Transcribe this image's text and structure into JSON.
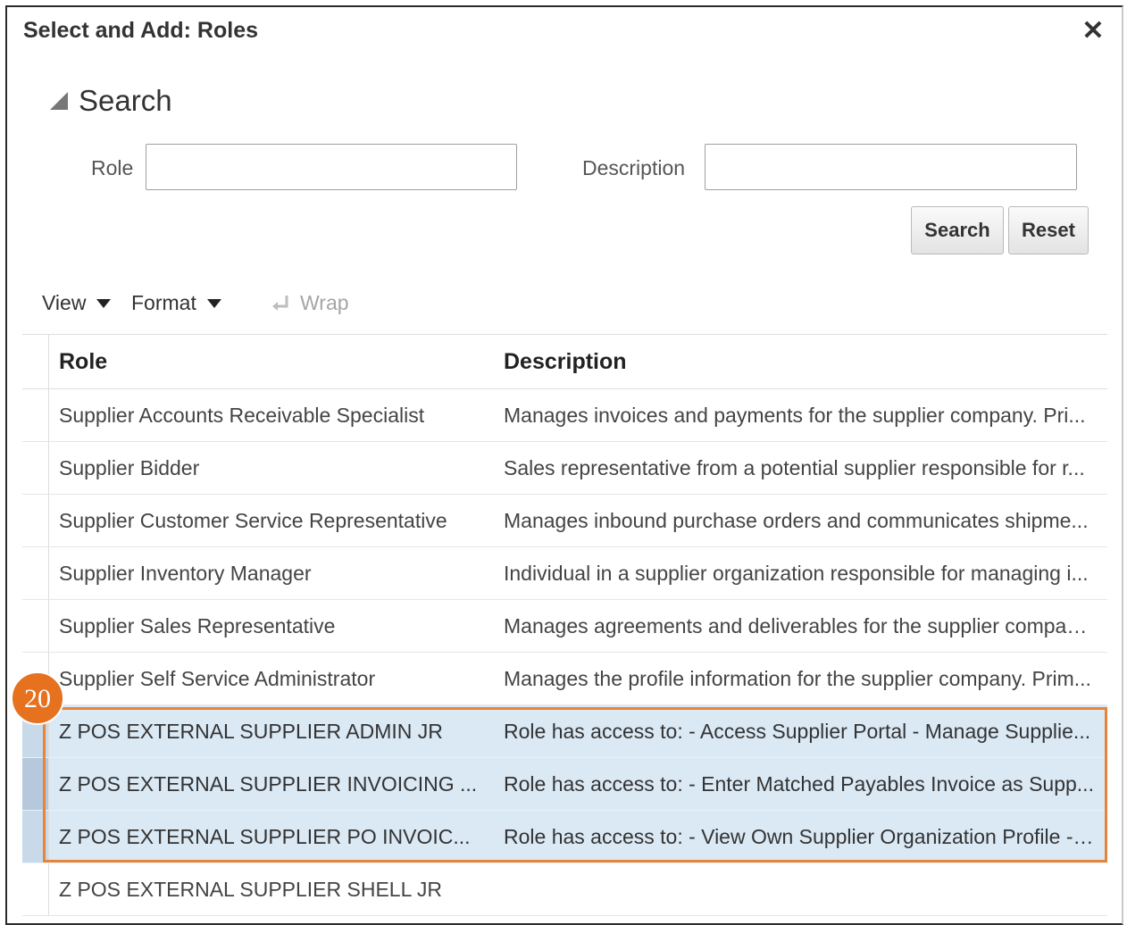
{
  "dialog": {
    "title": "Select and Add: Roles",
    "close_icon": "close-icon"
  },
  "search": {
    "section_title": "Search",
    "role_label": "Role",
    "role_value": "",
    "description_label": "Description",
    "description_value": "",
    "search_button": "Search",
    "reset_button": "Reset"
  },
  "toolbar": {
    "view_label": "View",
    "format_label": "Format",
    "wrap_label": "Wrap"
  },
  "table": {
    "headers": [
      "Role",
      "Description"
    ],
    "rows": [
      {
        "role": "Supplier Accounts Receivable Specialist",
        "description": "Manages invoices and payments for the supplier company. Pri..."
      },
      {
        "role": "Supplier Bidder",
        "description": "Sales representative from a potential supplier responsible for r..."
      },
      {
        "role": "Supplier Customer Service Representative",
        "description": "Manages inbound purchase orders and communicates shipme..."
      },
      {
        "role": "Supplier Inventory Manager",
        "description": "Individual in a supplier organization responsible for managing i..."
      },
      {
        "role": "Supplier Sales Representative",
        "description": "Manages agreements and deliverables for the supplier compan..."
      },
      {
        "role": "Supplier Self Service Administrator",
        "description": "Manages the profile information for the supplier company. Prim..."
      },
      {
        "role": "Z POS EXTERNAL SUPPLIER ADMIN JR",
        "description": "Role has access to: - Access Supplier Portal - Manage Supplie..."
      },
      {
        "role": "Z POS EXTERNAL SUPPLIER INVOICING ...",
        "description": "Role has access to: - Enter Matched Payables Invoice as Supp..."
      },
      {
        "role": "Z POS EXTERNAL SUPPLIER PO INVOIC...",
        "description": "Role has access to: - View Own Supplier Organization Profile - ..."
      },
      {
        "role": "Z POS EXTERNAL SUPPLIER SHELL JR",
        "description": ""
      }
    ]
  },
  "annotation": {
    "step_number": "20",
    "accent_color": "#e6711f"
  }
}
